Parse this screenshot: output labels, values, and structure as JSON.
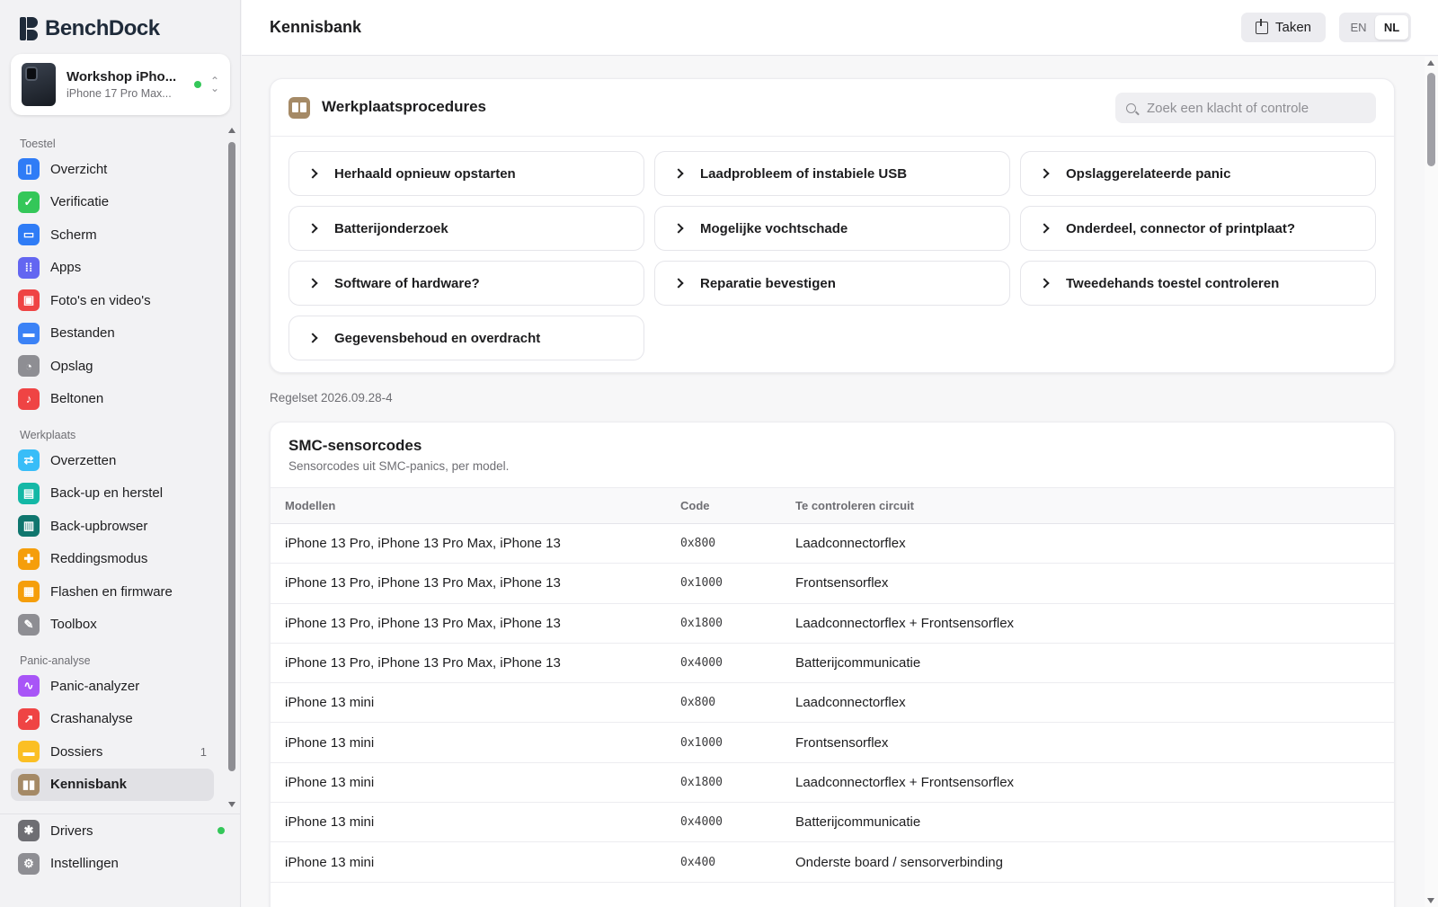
{
  "app": {
    "name_part1": "Bench",
    "name_part2": "Dock"
  },
  "device": {
    "name": "Workshop iPho...",
    "model": "iPhone 17 Pro Max...",
    "status_color": "#34c759"
  },
  "sidebar": {
    "sections": [
      {
        "label": "Toestel",
        "items": [
          {
            "label": "Overzicht",
            "icon": "phone-icon",
            "color": "#2f7cf6",
            "glyph": "▯"
          },
          {
            "label": "Verificatie",
            "icon": "shield-check-icon",
            "color": "#34c759",
            "glyph": "✓"
          },
          {
            "label": "Scherm",
            "icon": "screen-icon",
            "color": "#2f7cf6",
            "glyph": "▭"
          },
          {
            "label": "Apps",
            "icon": "apps-grid-icon",
            "color": "#6366f1",
            "glyph": "⁞⁞"
          },
          {
            "label": "Foto's en video's",
            "icon": "photos-icon",
            "color": "#ef4444",
            "glyph": "▣"
          },
          {
            "label": "Bestanden",
            "icon": "folder-icon",
            "color": "#3b82f6",
            "glyph": "▬"
          },
          {
            "label": "Opslag",
            "icon": "storage-pie-icon",
            "color": "#8e8e93",
            "glyph": "◔"
          },
          {
            "label": "Beltonen",
            "icon": "music-note-icon",
            "color": "#ef4444",
            "glyph": "♪"
          }
        ]
      },
      {
        "label": "Werkplaats",
        "items": [
          {
            "label": "Overzetten",
            "icon": "transfer-icon",
            "color": "#38bdf8",
            "glyph": "⇄"
          },
          {
            "label": "Back-up en herstel",
            "icon": "backup-icon",
            "color": "#14b8a6",
            "glyph": "▤"
          },
          {
            "label": "Back-upbrowser",
            "icon": "backup-browser-icon",
            "color": "#0f766e",
            "glyph": "▥"
          },
          {
            "label": "Reddingsmodus",
            "icon": "lifebuoy-icon",
            "color": "#f59e0b",
            "glyph": "✚"
          },
          {
            "label": "Flashen en firmware",
            "icon": "chip-icon",
            "color": "#f59e0b",
            "glyph": "▦"
          },
          {
            "label": "Toolbox",
            "icon": "wrench-icon",
            "color": "#8e8e93",
            "glyph": "✎"
          }
        ]
      },
      {
        "label": "Panic-analyse",
        "items": [
          {
            "label": "Panic-analyzer",
            "icon": "waveform-icon",
            "color": "#a855f7",
            "glyph": "∿"
          },
          {
            "label": "Crashanalyse",
            "icon": "chart-line-icon",
            "color": "#ef4444",
            "glyph": "↗"
          },
          {
            "label": "Dossiers",
            "icon": "dossier-folder-icon",
            "color": "#fbbf24",
            "glyph": "▬",
            "count": "1"
          },
          {
            "label": "Kennisbank",
            "icon": "book-icon",
            "color": "#a58a66",
            "glyph": "▮▮",
            "active": true
          }
        ]
      }
    ],
    "bottom": [
      {
        "label": "Drivers",
        "icon": "puzzle-icon",
        "color": "#6e6e73",
        "glyph": "✱",
        "status_dot": true
      },
      {
        "label": "Instellingen",
        "icon": "gear-icon",
        "color": "#8e8e93",
        "glyph": "⚙"
      }
    ]
  },
  "header": {
    "title": "Kennisbank",
    "tasks_label": "Taken",
    "lang_en": "EN",
    "lang_nl": "NL",
    "lang_selected": "NL"
  },
  "procedures": {
    "title": "Werkplaatsprocedures",
    "search_placeholder": "Zoek een klacht of controle",
    "items": [
      "Herhaald opnieuw opstarten",
      "Laadprobleem of instabiele USB",
      "Opslaggerelateerde panic",
      "Batterijonderzoek",
      "Mogelijke vochtschade",
      "Onderdeel, connector of printplaat?",
      "Software of hardware?",
      "Reparatie bevestigen",
      "Tweedehands toestel controleren",
      "Gegevensbehoud en overdracht"
    ]
  },
  "ruleset": "Regelset 2026.09.28-4",
  "smc": {
    "title": "SMC-sensorcodes",
    "subtitle": "Sensorcodes uit SMC-panics, per model.",
    "columns": [
      "Modellen",
      "Code",
      "Te controleren circuit"
    ],
    "rows": [
      [
        "iPhone 13 Pro, iPhone 13 Pro Max, iPhone 13",
        "0x800",
        "Laadconnectorflex"
      ],
      [
        "iPhone 13 Pro, iPhone 13 Pro Max, iPhone 13",
        "0x1000",
        "Frontsensorflex"
      ],
      [
        "iPhone 13 Pro, iPhone 13 Pro Max, iPhone 13",
        "0x1800",
        "Laadconnectorflex + Frontsensorflex"
      ],
      [
        "iPhone 13 Pro, iPhone 13 Pro Max, iPhone 13",
        "0x4000",
        "Batterijcommunicatie"
      ],
      [
        "iPhone 13 mini",
        "0x800",
        "Laadconnectorflex"
      ],
      [
        "iPhone 13 mini",
        "0x1000",
        "Frontsensorflex"
      ],
      [
        "iPhone 13 mini",
        "0x1800",
        "Laadconnectorflex + Frontsensorflex"
      ],
      [
        "iPhone 13 mini",
        "0x4000",
        "Batterijcommunicatie"
      ],
      [
        "iPhone 13 mini",
        "0x400",
        "Onderste board / sensorverbinding"
      ]
    ]
  }
}
